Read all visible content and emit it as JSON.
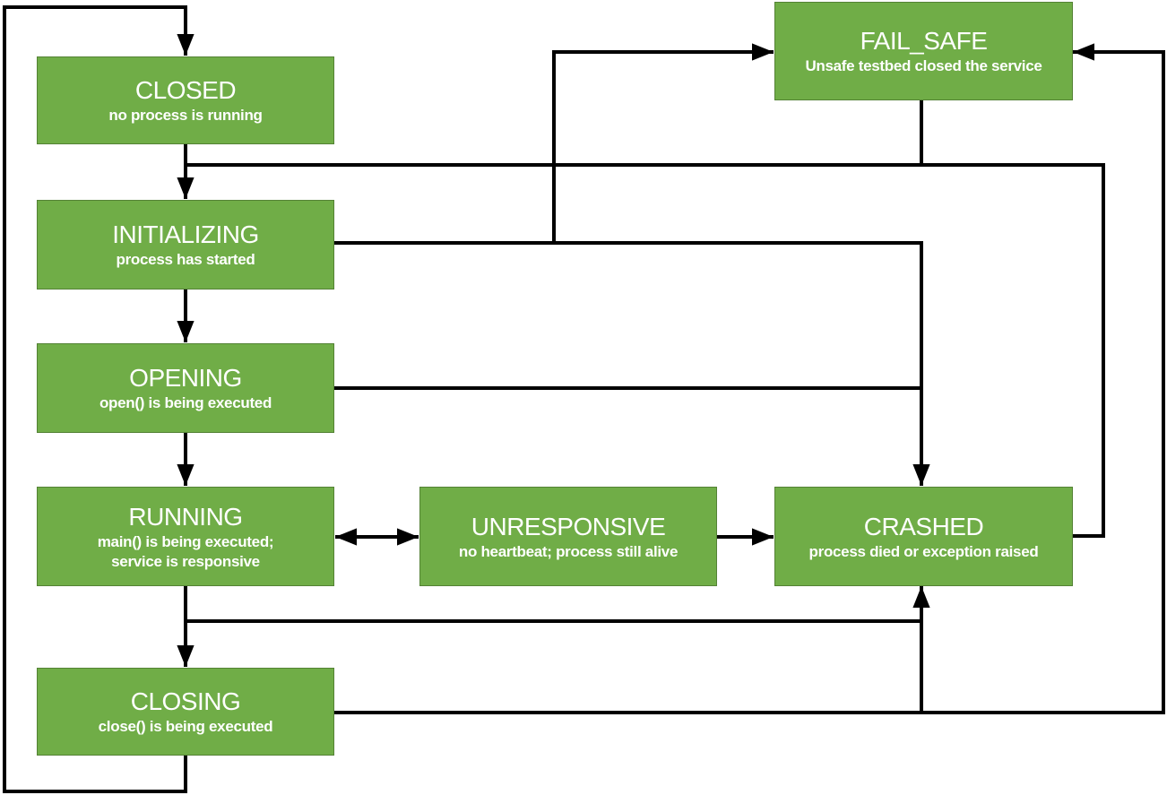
{
  "colors": {
    "state_fill": "#70AD47",
    "state_border": "#548235",
    "arrow": "#000000",
    "text": "#FFFFFF"
  },
  "states": {
    "closed": {
      "title": "CLOSED",
      "desc": [
        "no process is running"
      ]
    },
    "initializing": {
      "title": "INITIALIZING",
      "desc": [
        "process has started"
      ]
    },
    "opening": {
      "title": "OPENING",
      "desc": [
        "open() is being executed"
      ]
    },
    "running": {
      "title": "RUNNING",
      "desc": [
        "main() is being executed;",
        "service is responsive"
      ]
    },
    "unresponsive": {
      "title": "UNRESPONSIVE",
      "desc": [
        "no heartbeat; process still alive"
      ]
    },
    "crashed": {
      "title": "CRASHED",
      "desc": [
        "process died or exception raised"
      ]
    },
    "fail_safe": {
      "title": "FAIL_SAFE",
      "desc": [
        "Unsafe testbed closed the service"
      ]
    },
    "closing": {
      "title": "CLOSING",
      "desc": [
        "close() is being executed"
      ]
    }
  }
}
